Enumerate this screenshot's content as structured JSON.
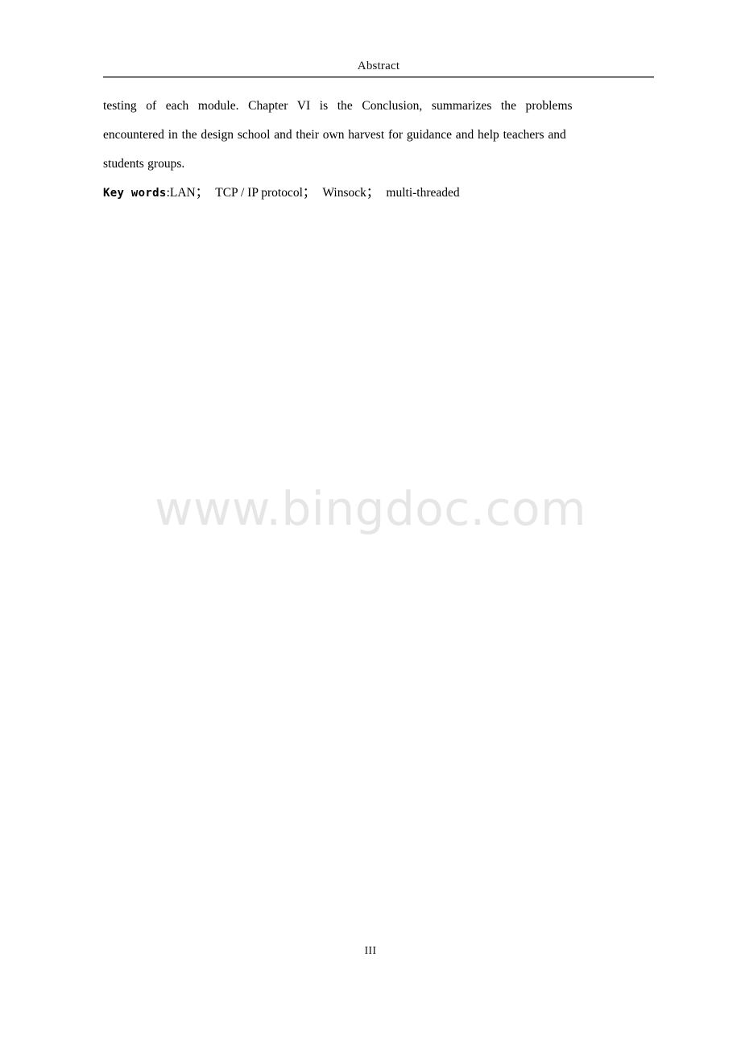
{
  "document": {
    "header": {
      "title": "Abstract"
    },
    "body": {
      "paragraph_lines": [
        "testing of each module. Chapter VI is the Conclusion, summarizes the problems",
        "encountered in the design school and their own harvest for guidance and help teachers and",
        "students groups."
      ],
      "paragraph_full": "testing of each module. Chapter VI is the Conclusion, summarizes the problems encountered in the design school and their own harvest for guidance and help teachers and students groups."
    },
    "keywords": {
      "label": "Key words",
      "colon": ":",
      "separator": "；",
      "terms": [
        "LAN",
        "TCP / IP protocol",
        "Winsock",
        "multi-threaded"
      ]
    },
    "watermark": {
      "text": "www.bingdoc.com",
      "color": "#e6e6e6"
    },
    "footer": {
      "page_number": "III"
    }
  }
}
